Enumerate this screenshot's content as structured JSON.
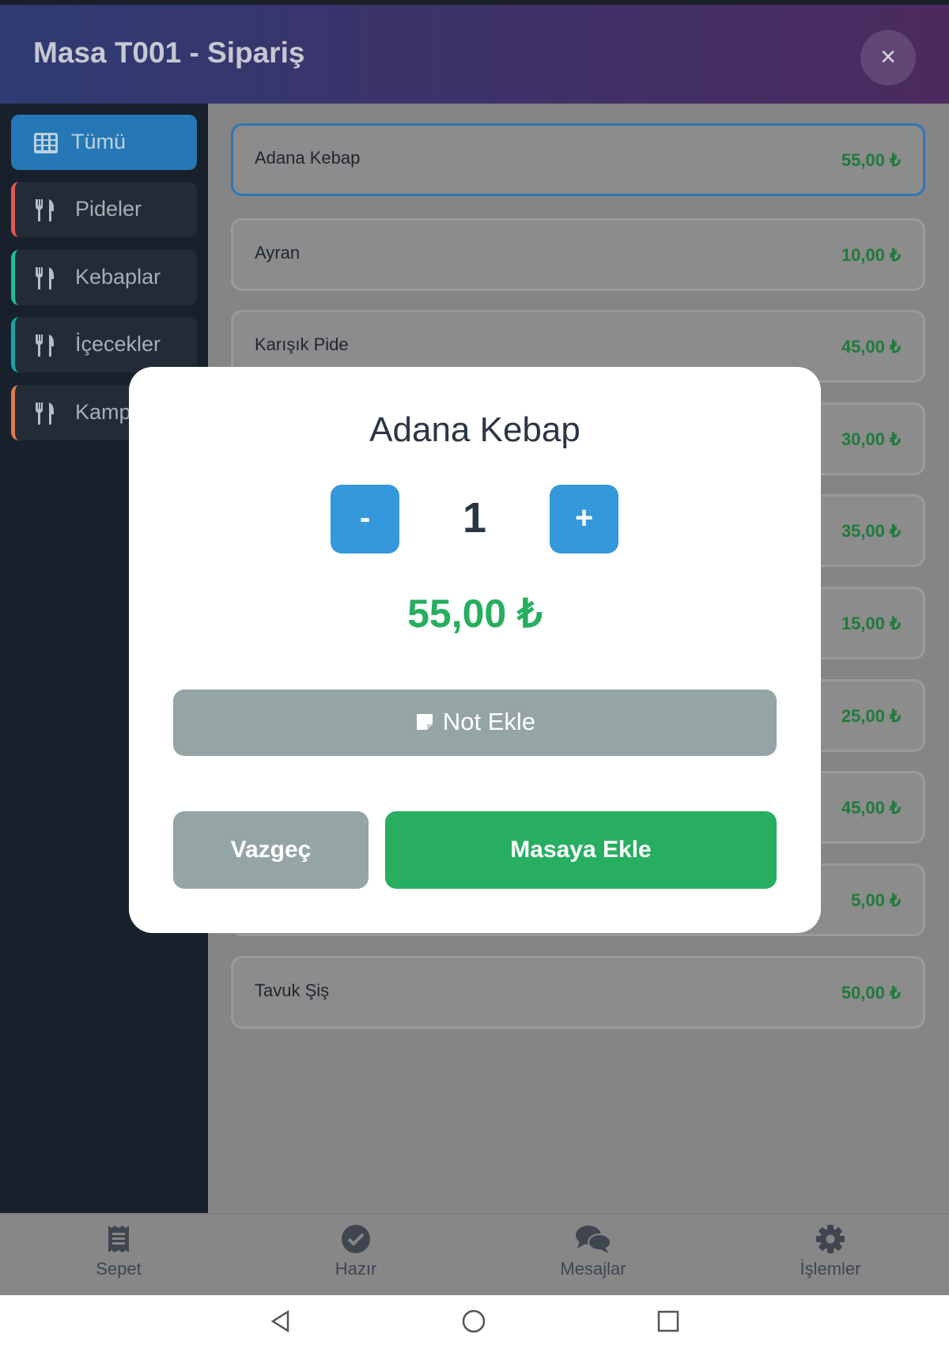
{
  "header": {
    "title": "Masa T001 - Sipariş",
    "close_label": "×"
  },
  "sidebar": {
    "categories": [
      {
        "label": "Tümü",
        "icon": "grid-icon",
        "active": true
      },
      {
        "label": "Pideler",
        "icon": "utensils-icon",
        "accent": "#e05a4f"
      },
      {
        "label": "Kebaplar",
        "icon": "utensils-icon",
        "accent": "#1abc9c"
      },
      {
        "label": "İçecekler",
        "icon": "utensils-icon",
        "accent": "#16a5a5"
      },
      {
        "label": "Kamp",
        "icon": "utensils-icon",
        "accent": "#e07a4f"
      }
    ]
  },
  "products": [
    {
      "name": "Adana Kebap",
      "price": "55,00 ₺",
      "selected": true
    },
    {
      "name": "Ayran",
      "price": "10,00 ₺"
    },
    {
      "name": "Karışık Pide",
      "price": "45,00 ₺"
    },
    {
      "name": "",
      "price": "30,00 ₺"
    },
    {
      "name": "",
      "price": "35,00 ₺"
    },
    {
      "name": "",
      "price": "15,00 ₺"
    },
    {
      "name": "",
      "price": "25,00 ₺"
    },
    {
      "name": "",
      "price": "45,00 ₺"
    },
    {
      "name": "",
      "price": "5,00 ₺"
    },
    {
      "name": "Tavuk Şiş",
      "price": "50,00 ₺"
    }
  ],
  "modal": {
    "title": "Adana Kebap",
    "decrement_label": "-",
    "increment_label": "+",
    "quantity": "1",
    "price": "55,00 ₺",
    "note_label": "Not Ekle",
    "cancel_label": "Vazgeç",
    "add_label": "Masaya Ekle"
  },
  "bottom_nav": [
    {
      "label": "Sepet",
      "icon": "receipt-icon"
    },
    {
      "label": "Hazır",
      "icon": "check-circle-icon"
    },
    {
      "label": "Mesajlar",
      "icon": "comments-icon"
    },
    {
      "label": "İşlemler",
      "icon": "gear-icon"
    }
  ],
  "system_nav": [
    "back-icon",
    "home-icon",
    "recents-icon"
  ],
  "colors": {
    "accent_blue": "#3498db",
    "success_green": "#27ae60",
    "muted_gray": "#95a5a6"
  }
}
